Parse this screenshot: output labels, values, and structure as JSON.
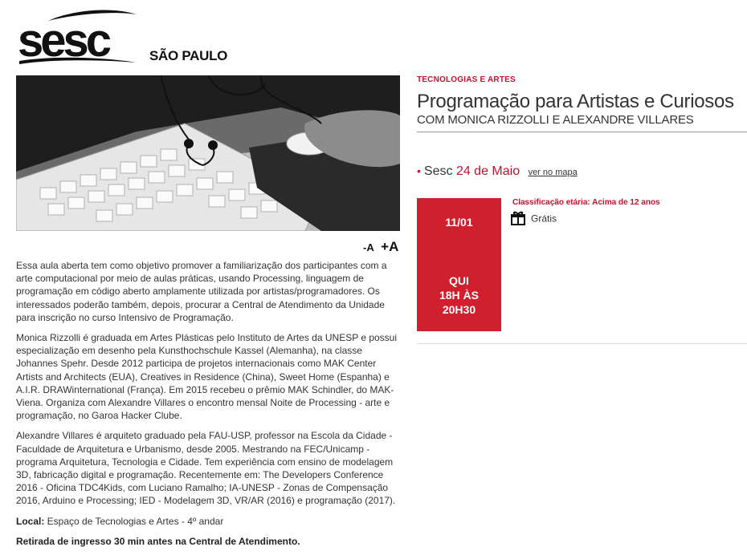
{
  "brand": {
    "wordmark": "sesc",
    "city": "SÃO PAULO"
  },
  "hero_image": {
    "alt": ""
  },
  "font_controls": {
    "decrease": "-A",
    "increase": "+A"
  },
  "description": {
    "p1": "Essa aula aberta tem como objetivo promover a familiarização dos participantes com a arte computacional por meio de aulas práticas, usando Processing, linguagem de programação em código aberto amplamente utilizada por artistas/programadores. Os interessados poderão também, depois, procurar a Central de Atendimento da Unidade para inscrição no curso Intensivo de Programação.",
    "p2": "Monica Rizzolli é graduada em Artes Plásticas pelo Instituto de Artes da UNESP e possui especialização em desenho pela Kunsthochschule Kassel (Alemanha), na classe Johannes Spehr. Desde 2012 participa de projetos internacionais como MAK Center Artists and Architects (EUA), Creatives in Residence (China), Sweet Home (Espanha) e A.I.R. DRAWinternational (França). Em 2015 recebeu o prêmio MAK Schindler, do MAK-Viena. Organiza com Alexandre Villares o encontro mensal Noite de Processing - arte e programação, no Garoa Hacker Clube.",
    "p3": "Alexandre Villares é arquiteto graduado pela FAU-USP, professor na Escola da Cidade - Faculdade de Arquitetura e Urbanismo, desde 2005. Mestrando na FEC/Unicamp - programa Arquitetura, Tecnologia e Cidade. Tem experiência com ensino de modelagem 3D, fabricação digital e programação. Recentemente em: The Developers Conference 2016 - Oficina TDC4Kids, com Luciano Ramalho; IA-UNESP - Zonas de Compensação 2016, Arduino e Processing; IED - Modelagem 3D, VR/AR (2016) e programação (2017).",
    "local_label": "Local:",
    "local_value": " Espaço de Tecnologias e Artes - 4º andar",
    "notice": "Retirada de ingresso 30 min antes na Central de Atendimento."
  },
  "event": {
    "category": "TECNOLOGIAS E ARTES",
    "title": "Programação para Artistas e Curiosos",
    "subtitle": "COM MONICA RIZZOLLI E ALEXANDRE VILLARES",
    "venue_name": "Sesc",
    "venue_unit": "24 de Maio",
    "map_link": "ver no mapa"
  },
  "schedule": {
    "date": "11/01",
    "time_line1": "QUI",
    "time_line2": "18H ÀS",
    "time_line3": "20H30",
    "classification": "Classificação etária: Acima de 12 anos",
    "price": "Grátis"
  },
  "colors": {
    "accent": "#c8102e",
    "box": "#d0202e",
    "text": "#333333"
  }
}
